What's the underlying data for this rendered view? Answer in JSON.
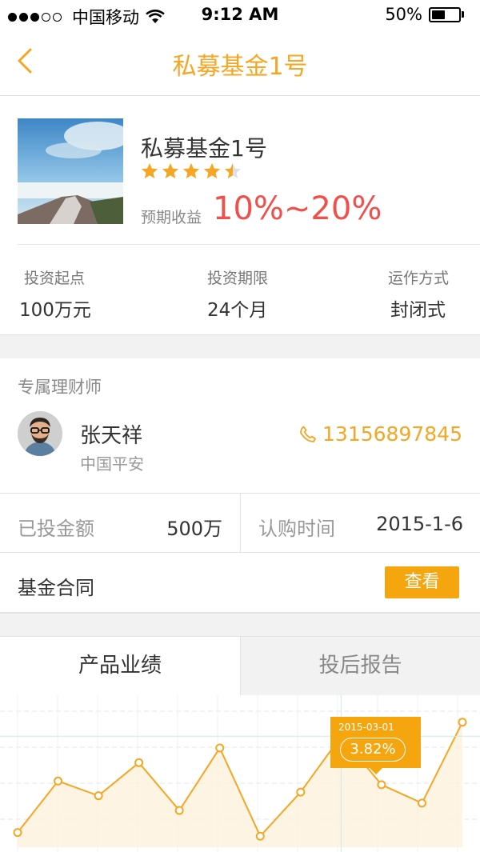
{
  "status_bar": {
    "carrier": "中国移动",
    "time": "9:12 AM",
    "battery_percent": "50%",
    "battery_level": 0.5,
    "signal_bars_filled": 3,
    "signal_bars_total": 5
  },
  "nav": {
    "title": "私募基金1号",
    "back_icon": "chevron-left-icon",
    "accent_color": "#f5a623"
  },
  "fund": {
    "name": "私募基金1号",
    "rating": 4.5,
    "rating_max": 5,
    "yield_label": "预期收益",
    "yield_value": "10%~20%",
    "yield_color": "#f0504b",
    "stats": [
      {
        "label": "投资起点",
        "value": "100万元"
      },
      {
        "label": "投资期限",
        "value": "24个月"
      },
      {
        "label": "运作方式",
        "value": "封闭式"
      }
    ]
  },
  "advisor": {
    "heading": "专属理财师",
    "name": "张天祥",
    "company": "中国平安",
    "phone": "13156897845",
    "phone_icon": "phone-icon"
  },
  "investment": {
    "amount_label": "已投金额",
    "amount_value": "500万",
    "date_label": "认购时间",
    "date_value": "2015-1-6"
  },
  "contract": {
    "label": "基金合同",
    "button_label": "查看"
  },
  "tabs": [
    {
      "label": "产品业绩",
      "active": true
    },
    {
      "label": "投后报告",
      "active": false
    }
  ],
  "chart_data": {
    "type": "area",
    "title": "",
    "xlabel": "",
    "ylabel": "",
    "grid": true,
    "series_color": "#f5a623",
    "values": [
      1.2,
      2.6,
      2.2,
      3.1,
      1.8,
      3.5,
      1.1,
      2.3,
      3.82,
      2.5,
      2.0,
      4.2
    ],
    "tooltip": {
      "date": "2015-03-01",
      "value": "3.82%",
      "point_index": 8
    }
  }
}
